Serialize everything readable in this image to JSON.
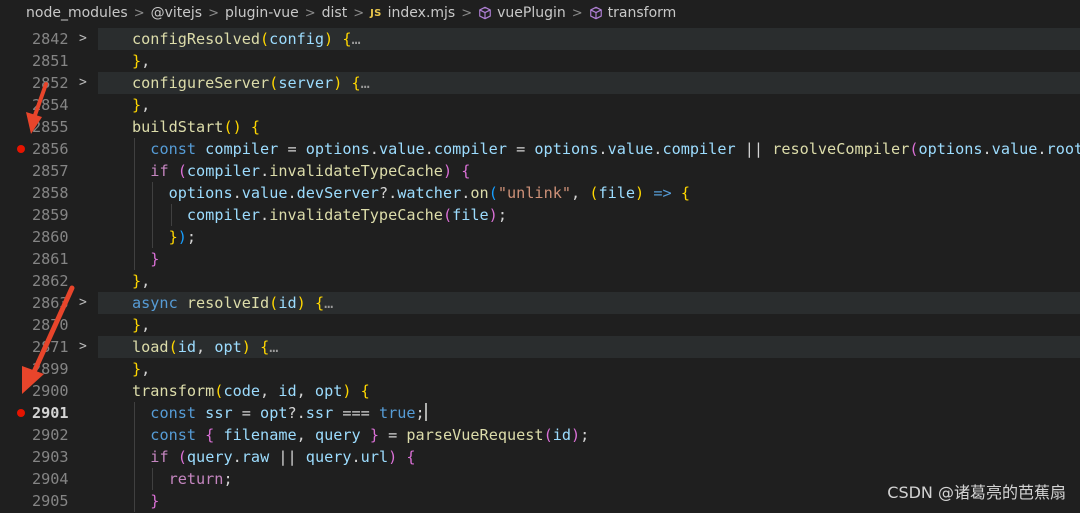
{
  "breadcrumb": {
    "items": [
      "node_modules",
      "@vitejs",
      "plugin-vue",
      "dist",
      "index.mjs",
      "vuePlugin",
      "transform"
    ],
    "file_badge": "JS",
    "separator": ">"
  },
  "colors": {
    "breakpoint": "#e51400",
    "annotation_arrow": "#e8452b",
    "background": "#1f1f1f"
  },
  "lines": [
    {
      "num": "2842",
      "fold": ">",
      "tokens": [
        [
          "fn",
          "configResolved"
        ],
        [
          "y1",
          "("
        ],
        [
          "vr",
          "config"
        ],
        [
          "y1",
          ")"
        ],
        [
          "pn",
          " "
        ],
        [
          "y1",
          "{"
        ],
        [
          "fd",
          "…"
        ]
      ]
    },
    {
      "num": "2851",
      "tokens": [
        [
          "y1",
          "}"
        ],
        [
          "pn",
          ","
        ]
      ]
    },
    {
      "num": "2852",
      "fold": ">",
      "tokens": [
        [
          "fn",
          "configureServer"
        ],
        [
          "y1",
          "("
        ],
        [
          "vr",
          "server"
        ],
        [
          "y1",
          ")"
        ],
        [
          "pn",
          " "
        ],
        [
          "y1",
          "{"
        ],
        [
          "fd",
          "…"
        ]
      ]
    },
    {
      "num": "2854",
      "tokens": [
        [
          "y1",
          "}"
        ],
        [
          "pn",
          ","
        ]
      ]
    },
    {
      "num": "2855",
      "tokens": [
        [
          "fn",
          "buildStart"
        ],
        [
          "y1",
          "()"
        ],
        [
          "pn",
          " "
        ],
        [
          "y1",
          "{"
        ]
      ]
    },
    {
      "num": "2856",
      "bp": true,
      "indent": 1,
      "tokens": [
        [
          "kw",
          "const"
        ],
        [
          "pn",
          " "
        ],
        [
          "vr",
          "compiler"
        ],
        [
          "pn",
          " = "
        ],
        [
          "vr",
          "options"
        ],
        [
          "pn",
          "."
        ],
        [
          "vr",
          "value"
        ],
        [
          "pn",
          "."
        ],
        [
          "vr",
          "compiler"
        ],
        [
          "pn",
          " = "
        ],
        [
          "vr",
          "options"
        ],
        [
          "pn",
          "."
        ],
        [
          "vr",
          "value"
        ],
        [
          "pn",
          "."
        ],
        [
          "vr",
          "compiler"
        ],
        [
          "pn",
          " || "
        ],
        [
          "fn",
          "resolveCompiler"
        ],
        [
          "p2",
          "("
        ],
        [
          "vr",
          "options"
        ],
        [
          "pn",
          "."
        ],
        [
          "vr",
          "value"
        ],
        [
          "pn",
          "."
        ],
        [
          "vr",
          "root"
        ],
        [
          "p2",
          ")"
        ],
        [
          "pn",
          ";"
        ]
      ]
    },
    {
      "num": "2857",
      "indent": 1,
      "tokens": [
        [
          "ctl",
          "if"
        ],
        [
          "pn",
          " "
        ],
        [
          "p2",
          "("
        ],
        [
          "vr",
          "compiler"
        ],
        [
          "pn",
          "."
        ],
        [
          "fn",
          "invalidateTypeCache"
        ],
        [
          "p2",
          ")"
        ],
        [
          "pn",
          " "
        ],
        [
          "p2",
          "{"
        ]
      ]
    },
    {
      "num": "2858",
      "indent": 2,
      "tokens": [
        [
          "vr",
          "options"
        ],
        [
          "pn",
          "."
        ],
        [
          "vr",
          "value"
        ],
        [
          "pn",
          "."
        ],
        [
          "vr",
          "devServer"
        ],
        [
          "pn",
          "?."
        ],
        [
          "vr",
          "watcher"
        ],
        [
          "pn",
          "."
        ],
        [
          "fn",
          "on"
        ],
        [
          "b3",
          "("
        ],
        [
          "str",
          "\"unlink\""
        ],
        [
          "pn",
          ", "
        ],
        [
          "y1",
          "("
        ],
        [
          "vr",
          "file"
        ],
        [
          "y1",
          ")"
        ],
        [
          "pn",
          " "
        ],
        [
          "kw",
          "=>"
        ],
        [
          "pn",
          " "
        ],
        [
          "y1",
          "{"
        ]
      ]
    },
    {
      "num": "2859",
      "indent": 3,
      "tokens": [
        [
          "vr",
          "compiler"
        ],
        [
          "pn",
          "."
        ],
        [
          "fn",
          "invalidateTypeCache"
        ],
        [
          "p2",
          "("
        ],
        [
          "vr",
          "file"
        ],
        [
          "p2",
          ")"
        ],
        [
          "pn",
          ";"
        ]
      ]
    },
    {
      "num": "2860",
      "indent": 2,
      "tokens": [
        [
          "y1",
          "}"
        ],
        [
          "b3",
          ")"
        ],
        [
          "pn",
          ";"
        ]
      ]
    },
    {
      "num": "2861",
      "indent": 1,
      "tokens": [
        [
          "p2",
          "}"
        ]
      ]
    },
    {
      "num": "2862",
      "tokens": [
        [
          "y1",
          "}"
        ],
        [
          "pn",
          ","
        ]
      ]
    },
    {
      "num": "2863",
      "fold": ">",
      "tokens": [
        [
          "kw",
          "async"
        ],
        [
          "pn",
          " "
        ],
        [
          "fn",
          "resolveId"
        ],
        [
          "y1",
          "("
        ],
        [
          "vr",
          "id"
        ],
        [
          "y1",
          ")"
        ],
        [
          "pn",
          " "
        ],
        [
          "y1",
          "{"
        ],
        [
          "fd",
          "…"
        ]
      ]
    },
    {
      "num": "2870",
      "tokens": [
        [
          "y1",
          "}"
        ],
        [
          "pn",
          ","
        ]
      ]
    },
    {
      "num": "2871",
      "fold": ">",
      "tokens": [
        [
          "fn",
          "load"
        ],
        [
          "y1",
          "("
        ],
        [
          "vr",
          "id"
        ],
        [
          "pn",
          ", "
        ],
        [
          "vr",
          "opt"
        ],
        [
          "y1",
          ")"
        ],
        [
          "pn",
          " "
        ],
        [
          "y1",
          "{"
        ],
        [
          "fd",
          "…"
        ]
      ]
    },
    {
      "num": "2899",
      "tokens": [
        [
          "y1",
          "}"
        ],
        [
          "pn",
          ","
        ]
      ]
    },
    {
      "num": "2900",
      "tokens": [
        [
          "fn",
          "transform"
        ],
        [
          "y1",
          "("
        ],
        [
          "vr",
          "code"
        ],
        [
          "pn",
          ", "
        ],
        [
          "vr",
          "id"
        ],
        [
          "pn",
          ", "
        ],
        [
          "vr",
          "opt"
        ],
        [
          "y1",
          ")"
        ],
        [
          "pn",
          " "
        ],
        [
          "y1",
          "{"
        ]
      ]
    },
    {
      "num": "2901",
      "bp": true,
      "active": true,
      "cursor": true,
      "indent": 1,
      "tokens": [
        [
          "kw",
          "const"
        ],
        [
          "pn",
          " "
        ],
        [
          "vr",
          "ssr"
        ],
        [
          "pn",
          " = "
        ],
        [
          "vr",
          "opt"
        ],
        [
          "pn",
          "?."
        ],
        [
          "vr",
          "ssr"
        ],
        [
          "pn",
          " === "
        ],
        [
          "kw",
          "true"
        ],
        [
          "pn",
          ";"
        ]
      ]
    },
    {
      "num": "2902",
      "indent": 1,
      "tokens": [
        [
          "kw",
          "const"
        ],
        [
          "pn",
          " "
        ],
        [
          "p2",
          "{"
        ],
        [
          "pn",
          " "
        ],
        [
          "vr",
          "filename"
        ],
        [
          "pn",
          ", "
        ],
        [
          "vr",
          "query"
        ],
        [
          "pn",
          " "
        ],
        [
          "p2",
          "}"
        ],
        [
          "pn",
          " = "
        ],
        [
          "fn",
          "parseVueRequest"
        ],
        [
          "p2",
          "("
        ],
        [
          "vr",
          "id"
        ],
        [
          "p2",
          ")"
        ],
        [
          "pn",
          ";"
        ]
      ]
    },
    {
      "num": "2903",
      "indent": 1,
      "tokens": [
        [
          "ctl",
          "if"
        ],
        [
          "pn",
          " "
        ],
        [
          "p2",
          "("
        ],
        [
          "vr",
          "query"
        ],
        [
          "pn",
          "."
        ],
        [
          "vr",
          "raw"
        ],
        [
          "pn",
          " || "
        ],
        [
          "vr",
          "query"
        ],
        [
          "pn",
          "."
        ],
        [
          "vr",
          "url"
        ],
        [
          "p2",
          ")"
        ],
        [
          "pn",
          " "
        ],
        [
          "p2",
          "{"
        ]
      ]
    },
    {
      "num": "2904",
      "indent": 2,
      "tokens": [
        [
          "ctl",
          "return"
        ],
        [
          "pn",
          ";"
        ]
      ]
    },
    {
      "num": "2905",
      "indent": 1,
      "tokens": [
        [
          "p2",
          "}"
        ]
      ]
    }
  ],
  "watermark": "CSDN @诸葛亮的芭蕉扇"
}
